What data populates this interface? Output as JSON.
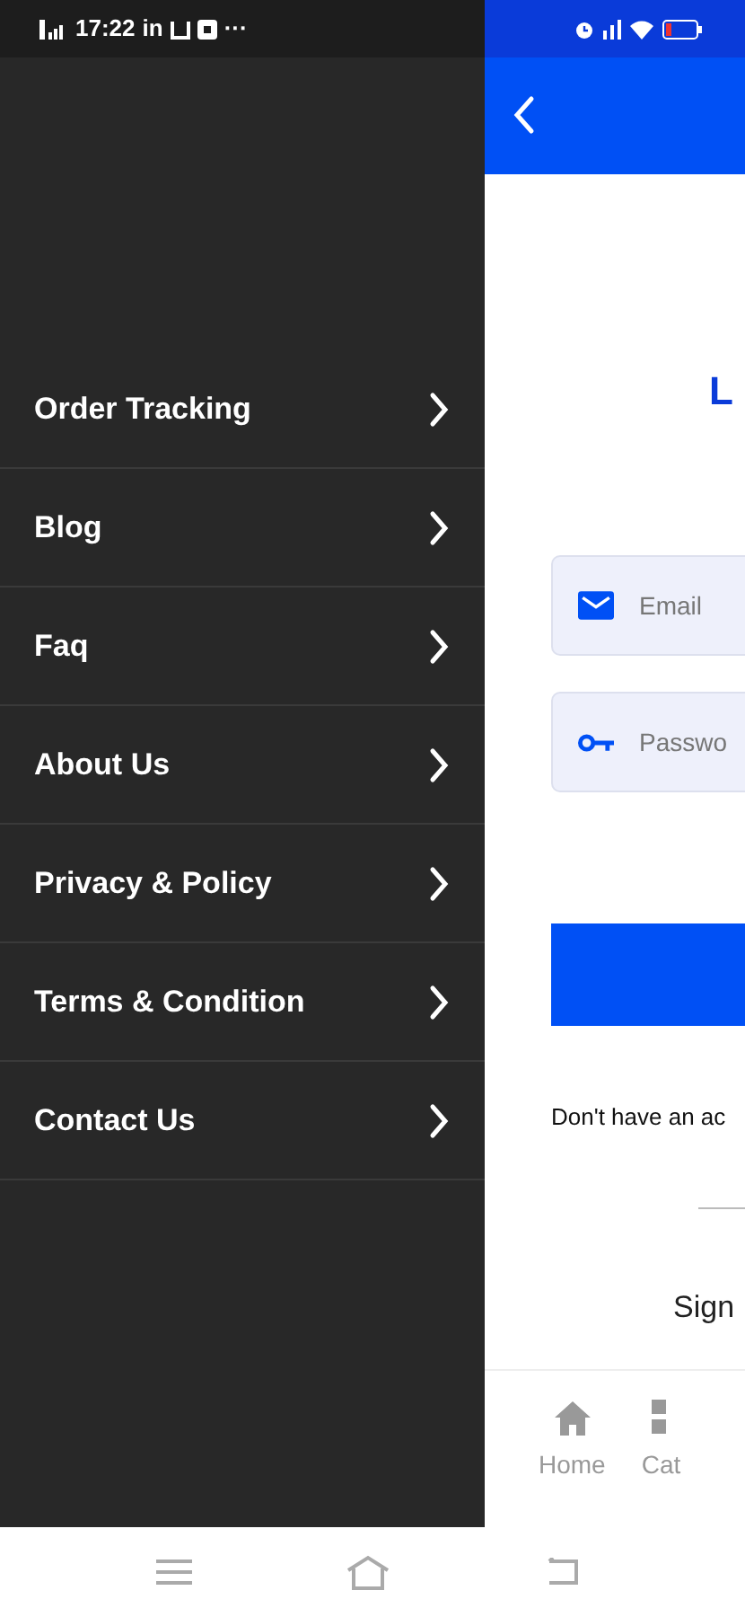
{
  "status_bar": {
    "time": "17:22",
    "app_label": "in",
    "more": "···"
  },
  "drawer": {
    "items": [
      {
        "label": "Order Tracking"
      },
      {
        "label": "Blog"
      },
      {
        "label": "Faq"
      },
      {
        "label": "About Us"
      },
      {
        "label": "Privacy & Policy"
      },
      {
        "label": "Terms & Condition"
      },
      {
        "label": "Contact Us"
      }
    ]
  },
  "login": {
    "title": "L",
    "fields": [
      {
        "kind": "email",
        "placeholder": "Email"
      },
      {
        "kind": "password",
        "placeholder": "Passwo"
      }
    ],
    "signup_prompt": "Don't have an ac",
    "sign_in_label": "Sign"
  },
  "bottom_nav": [
    {
      "kind": "home",
      "label": "Home"
    },
    {
      "kind": "category",
      "label": "Cat"
    }
  ]
}
